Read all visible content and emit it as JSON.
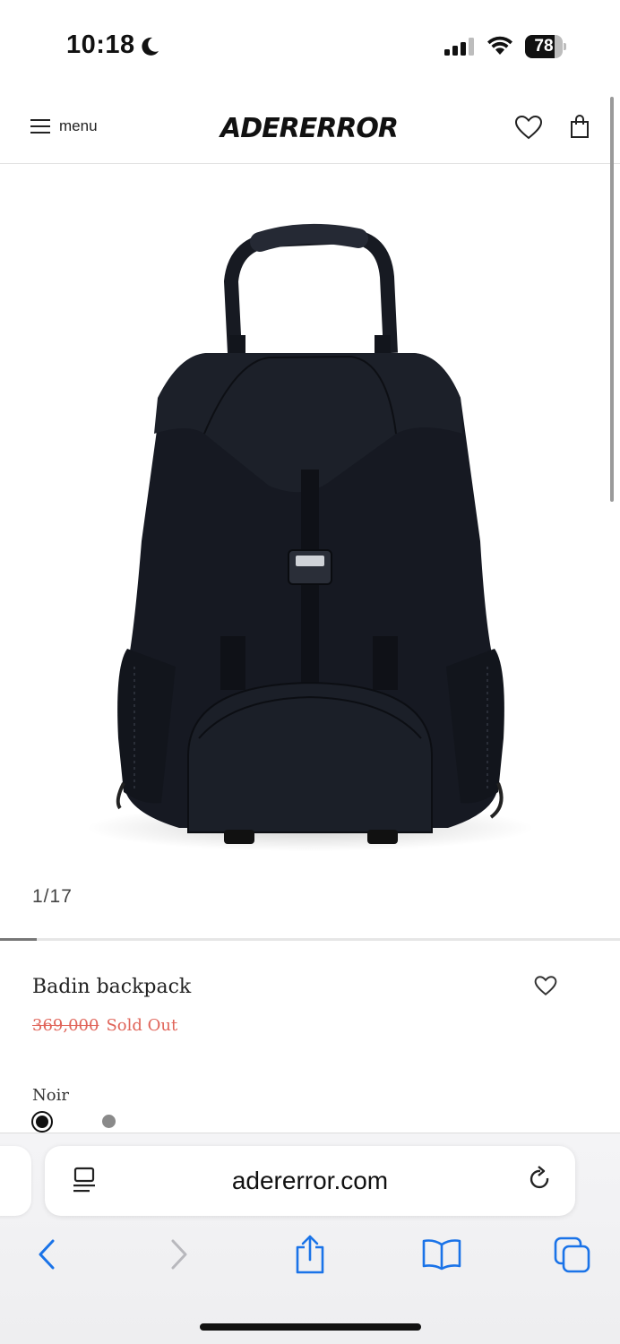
{
  "status_bar": {
    "time": "10:18",
    "battery_level": "78",
    "battery_fraction": 0.78
  },
  "header": {
    "menu_label": "menu",
    "logo_text": "ADERERROR",
    "icons": [
      "menu-icon",
      "heart-icon",
      "shopping-bag-icon"
    ]
  },
  "gallery": {
    "counter": "1/17",
    "current": 1,
    "total": 17,
    "progress_fraction": 0.0588
  },
  "product": {
    "name": "Badin backpack",
    "original_price": "369,000",
    "status": "Sold Out",
    "color_name": "Noir",
    "swatches": [
      "noir",
      "grey"
    ],
    "colors": {
      "sale_red": "#e06459",
      "noir": "#111111",
      "grey": "#8a8a8a"
    }
  },
  "browser": {
    "url": "adererror.com",
    "toolbar": [
      "back-icon",
      "forward-icon",
      "share-icon",
      "bookmarks-icon",
      "tabs-icon"
    ],
    "accent": "#1a73e8"
  }
}
